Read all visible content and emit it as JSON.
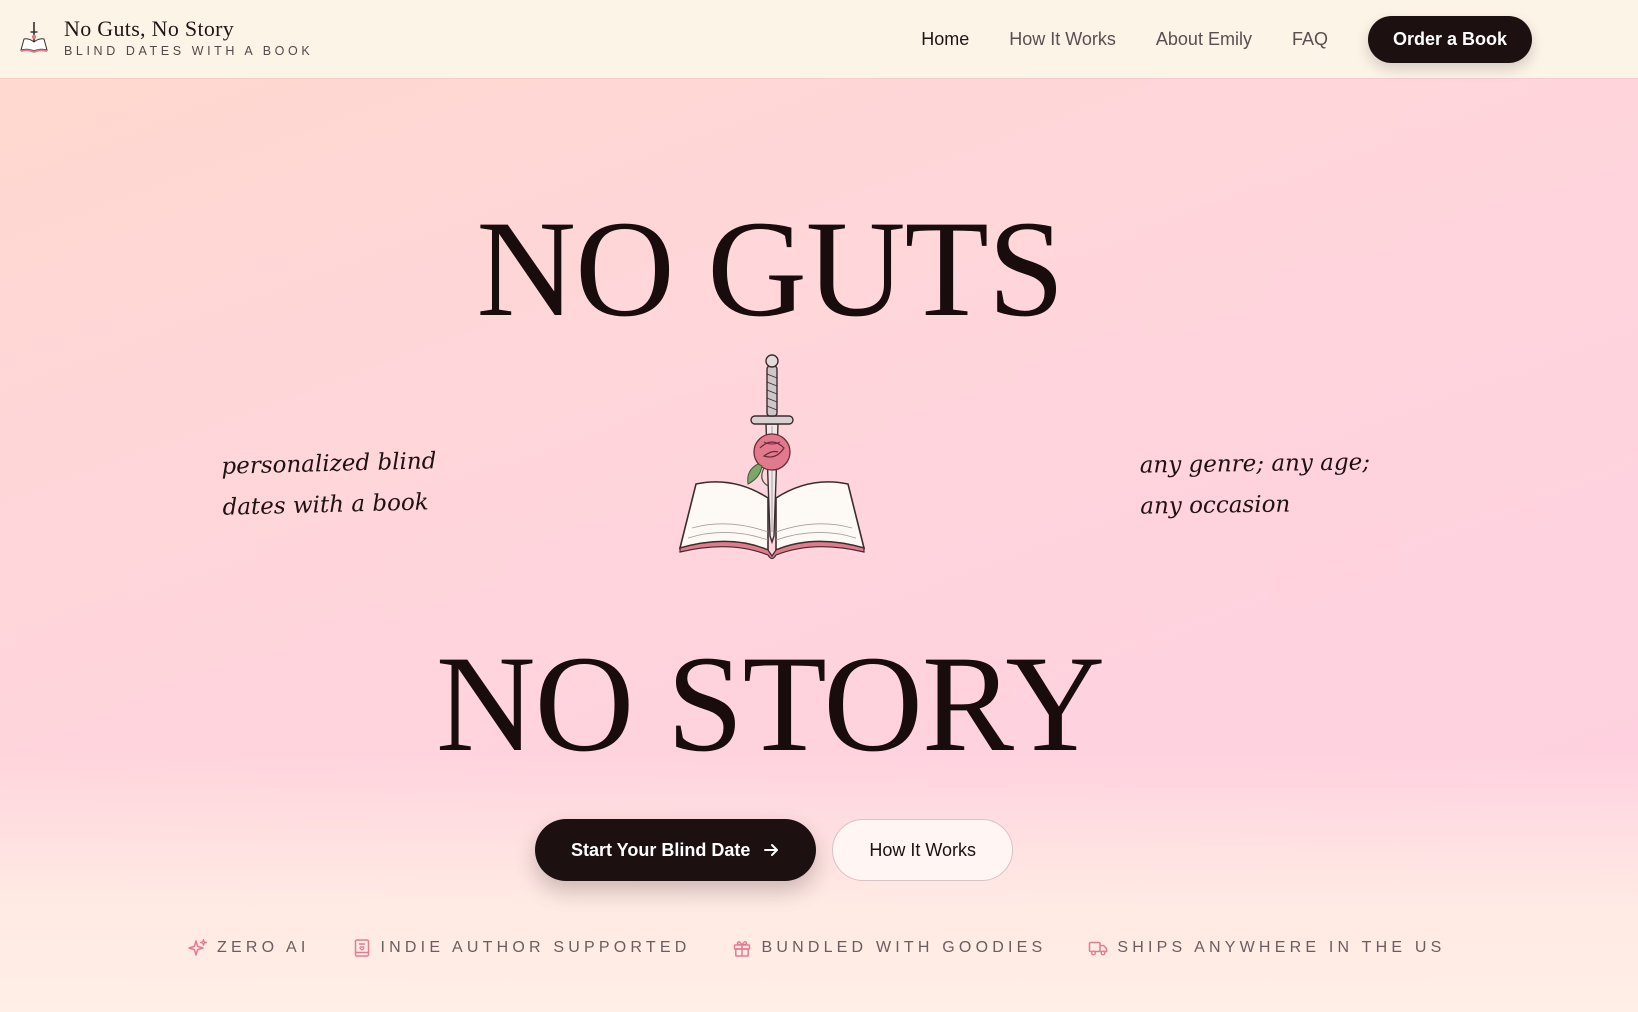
{
  "brand": {
    "title": "No Guts, No Story",
    "subtitle": "BLIND DATES WITH A BOOK",
    "logo_icon": "book-dagger-icon"
  },
  "nav": {
    "links": [
      {
        "label": "Home",
        "active": true
      },
      {
        "label": "How It Works",
        "active": false
      },
      {
        "label": "About Emily",
        "active": false
      },
      {
        "label": "FAQ",
        "active": false
      }
    ],
    "cta_label": "Order a Book"
  },
  "hero": {
    "line1": "NO GUTS",
    "line2": "NO STORY",
    "illustration": "dagger-rose-open-book-icon",
    "tagline_left": [
      "personalized blind",
      "dates with a book"
    ],
    "tagline_right": [
      "any genre; any age;",
      "any occasion"
    ]
  },
  "cta": {
    "primary_label": "Start Your Blind Date",
    "primary_icon": "arrow-right-icon",
    "secondary_label": "How It Works"
  },
  "features": [
    {
      "label": "ZERO AI",
      "icon": "sparkles-icon"
    },
    {
      "label": "INDIE AUTHOR SUPPORTED",
      "icon": "book-icon"
    },
    {
      "label": "BUNDLED WITH GOODIES",
      "icon": "gift-icon"
    },
    {
      "label": "SHIPS ANYWHERE IN THE US",
      "icon": "truck-icon"
    }
  ],
  "colors": {
    "ink": "#1c1011",
    "nav_background": "#fdf4e8",
    "accent_rose": "#e8798e",
    "background_peach": "#ffd8cd",
    "background_pink": "#ffd0e2"
  }
}
